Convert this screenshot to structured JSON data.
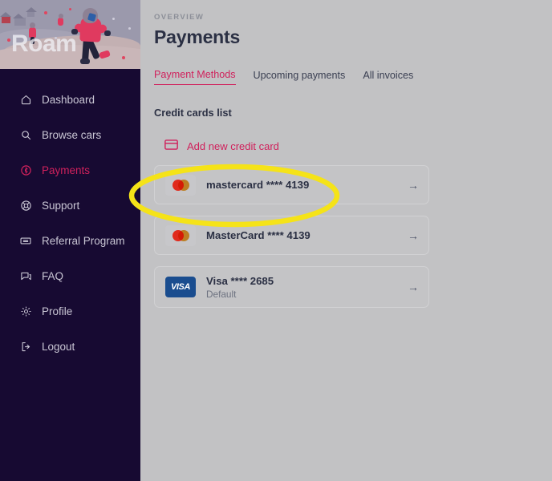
{
  "brand": {
    "logo_text": "Roam"
  },
  "sidebar": {
    "items": [
      {
        "label": "Dashboard",
        "icon": "home-icon",
        "active": false
      },
      {
        "label": "Browse cars",
        "icon": "search-icon",
        "active": false
      },
      {
        "label": "Payments",
        "icon": "dollar-circle-icon",
        "active": true
      },
      {
        "label": "Support",
        "icon": "lifebuoy-icon",
        "active": false
      },
      {
        "label": "Referral Program",
        "icon": "ticket-icon",
        "active": false
      },
      {
        "label": "FAQ",
        "icon": "chat-icon",
        "active": false
      },
      {
        "label": "Profile",
        "icon": "gear-icon",
        "active": false
      },
      {
        "label": "Logout",
        "icon": "logout-icon",
        "active": false
      }
    ]
  },
  "header": {
    "eyebrow": "OVERVIEW",
    "title": "Payments"
  },
  "tabs": [
    {
      "label": "Payment Methods",
      "active": true
    },
    {
      "label": "Upcoming payments",
      "active": false
    },
    {
      "label": "All invoices",
      "active": false
    }
  ],
  "main": {
    "section_label": "Credit cards list",
    "add_card_label": "Add new credit card",
    "add_card_icon": "credit-card-icon",
    "row_arrow_glyph": "→"
  },
  "cards": [
    {
      "brand": "mastercard",
      "title": "mastercard **** 4139",
      "subtitle": "",
      "badge": "mastercard-logo",
      "highlighted": true
    },
    {
      "brand": "mastercard",
      "title": "MasterCard **** 4139",
      "subtitle": "",
      "badge": "mastercard-logo",
      "highlighted": false
    },
    {
      "brand": "visa",
      "title": "Visa **** 2685",
      "subtitle": "Default",
      "badge": "visa-logo",
      "badge_text": "VISA",
      "highlighted": false
    }
  ],
  "annotation": {
    "type": "ellipse-highlight",
    "color": "#f5e318",
    "target": "mastercard **** 4139"
  },
  "colors": {
    "accent": "#d0215c",
    "sidebar_bg": "#170a32",
    "page_bg": "#c2c2c4",
    "text_dark": "#2b3044",
    "highlight": "#f5e318"
  }
}
